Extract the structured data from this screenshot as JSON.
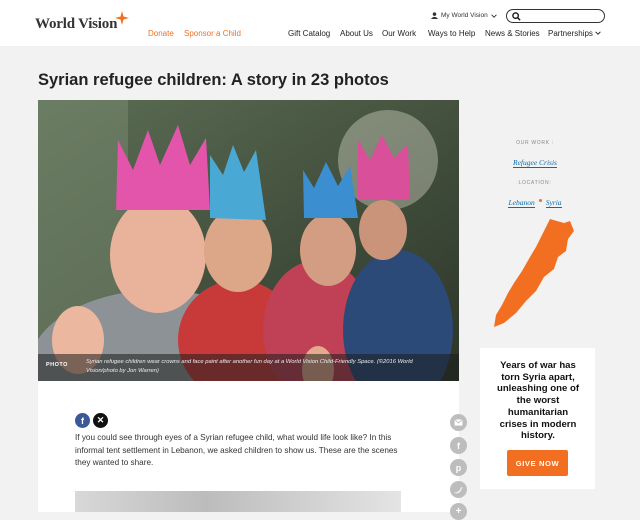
{
  "header": {
    "logo_text": "World Vision",
    "donate": "Donate",
    "sponsor": "Sponsor a Child",
    "my_world_vision": "My World Vision",
    "nav": [
      "Gift Catalog",
      "About Us",
      "Our Work",
      "Ways to Help",
      "News & Stories",
      "Partnerships"
    ]
  },
  "article": {
    "title": "Syrian refugee children: A story in 23 photos",
    "photo_label": "PHOTO",
    "caption": "Syrian refugee children wear crowns and face paint after another fun day at a World Vision Child-Friendly Space. (©2016 World Vision/photo by Jon Warren)",
    "intro": "If you could see through eyes of a Syrian refugee child, what would life look like? In this informal tent settlement in Lebanon, we asked children to show us. These are the scenes they wanted to share."
  },
  "sidebar": {
    "our_work_label": "OUR WORK :",
    "our_work_link": "Refugee Crisis",
    "location_label": "LOCATION:",
    "locations": [
      "Lebanon",
      "Syria"
    ],
    "promo_text": "Years of war has torn Syria apart, unleashing one of the worst humanitarian crises in modern history.",
    "give_button": "GIVE NOW"
  },
  "colors": {
    "brand_orange": "#f26f21",
    "link_blue": "#0f6ca6",
    "facebook": "#3b5998",
    "x": "#111111"
  },
  "icons": [
    "search-icon",
    "user-icon",
    "chevron-down-icon",
    "facebook-icon",
    "x-icon",
    "email-icon",
    "pinterest-icon",
    "twitter-icon"
  ]
}
